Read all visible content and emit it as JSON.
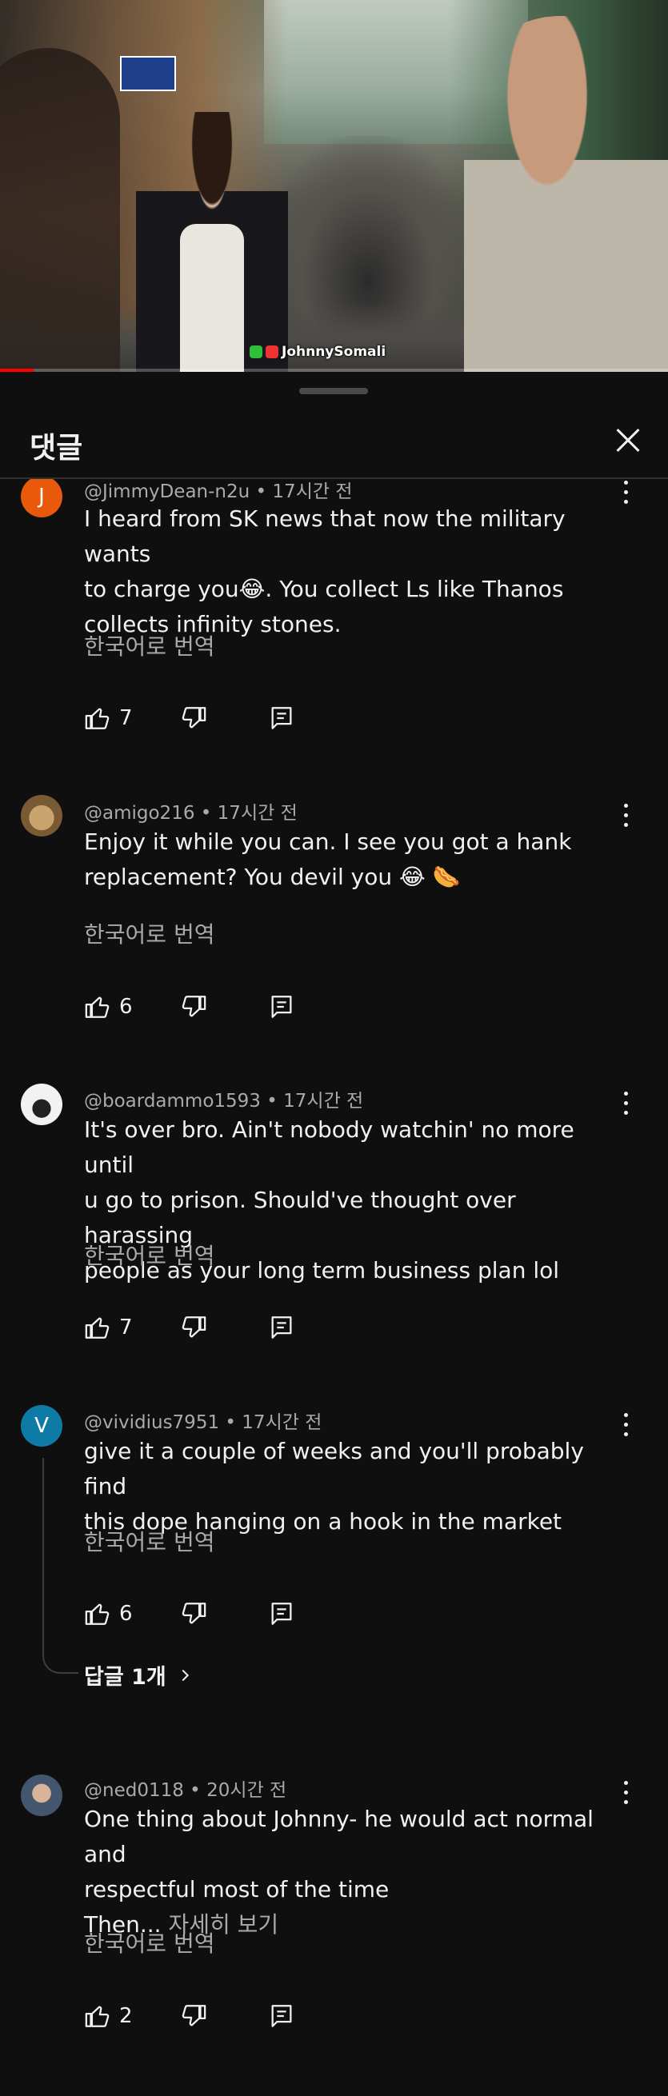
{
  "video": {
    "channel_watermark": "JohnnySomali",
    "progress": 0.05,
    "colors": {
      "progress": "#ff0000"
    }
  },
  "sheet": {
    "title": "댓글",
    "close_icon": "close-icon"
  },
  "comments": [
    {
      "author": "@JimmyDean-n2u",
      "time": "17시간 전",
      "avatar_letter": "J",
      "avatar_color": "#e8590c",
      "lines": [
        "I heard from SK news that now the military wants",
        "to charge you😂. You collect Ls like Thanos",
        "collects infinity stones."
      ],
      "translate": "한국어로 번역",
      "likes": "7"
    },
    {
      "author": "@amigo216",
      "time": "17시간 전",
      "avatar_letter": "",
      "avatar_color": "#8a6a3c",
      "lines": [
        "Enjoy it while you can. I see you got a hank",
        "replacement? You devil you 😂 🌭"
      ],
      "translate": "한국어로 번역",
      "likes": "6"
    },
    {
      "author": "@boardammo1593",
      "time": "17시간 전",
      "avatar_letter": "",
      "avatar_color": "#e8e8e8",
      "lines": [
        "It's over bro.  Ain't nobody watchin' no more until",
        "u go to prison.  Should've thought over harassing",
        "people as your long term business plan lol"
      ],
      "translate": "한국어로 번역",
      "likes": "7"
    },
    {
      "author": "@vividius7951",
      "time": "17시간 전",
      "avatar_letter": "V",
      "avatar_color": "#0e7aa6",
      "lines": [
        "give it a couple of weeks and you'll probably find",
        "this dope hanging on a hook in the market"
      ],
      "translate": "한국어로 번역",
      "likes": "6",
      "replies": "답글 1개"
    },
    {
      "author": "@ned0118",
      "time": "20시간 전",
      "avatar_letter": "",
      "avatar_color": "#6b7f95",
      "lines": [
        "One thing about Johnny- he would act normal and",
        "respectful most of the time"
      ],
      "more_prefix": "Then...",
      "more_label": "자세히 보기",
      "translate": "한국어로 번역",
      "likes": "2"
    }
  ],
  "icons": {
    "like": "thumb-up-icon",
    "dislike": "thumb-down-icon",
    "reply": "reply-icon",
    "menu": "more-vert-icon"
  }
}
